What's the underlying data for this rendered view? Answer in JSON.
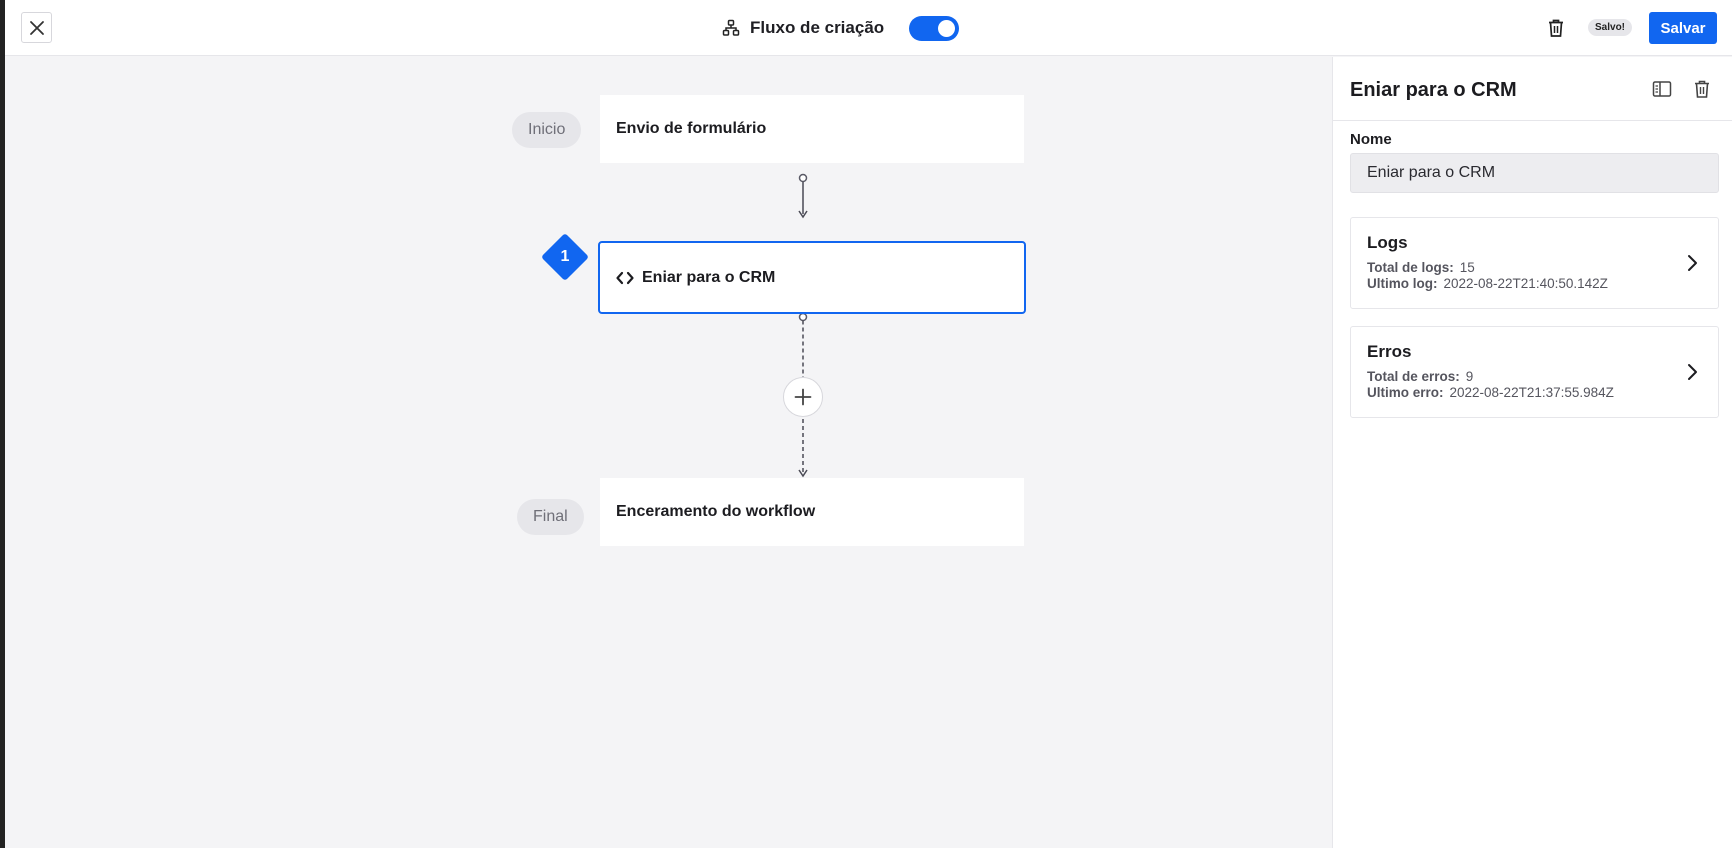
{
  "topbar": {
    "close_icon": "close-icon",
    "flow_icon": "flow-tree-icon",
    "title": "Fluxo de criação",
    "toggle_on": true,
    "trash_icon": "trash-icon",
    "saved_badge": "Salvo!",
    "save_label": "Salvar"
  },
  "canvas": {
    "start_tag": "Inicio",
    "end_tag": "Final",
    "nodes": [
      {
        "label": "Envio de formulário"
      },
      {
        "label": "Eniar para o CRM",
        "number": "1",
        "icon": "code-icon"
      },
      {
        "label": "Enceramento do workflow"
      }
    ],
    "add_icon": "plus-icon"
  },
  "panel": {
    "title": "Eniar para o CRM",
    "layout_icon": "panel-layout-icon",
    "trash_icon": "trash-icon",
    "name_label": "Nome",
    "name_value": "Eniar para o CRM",
    "logs": {
      "title": "Logs",
      "total_label": "Total de logs:",
      "total_value": "15",
      "last_label": "Ultimo log:",
      "last_value": "2022-08-22T21:40:50.142Z"
    },
    "errors": {
      "title": "Erros",
      "total_label": "Total de erros:",
      "total_value": "9",
      "last_label": "Ultimo erro:",
      "last_value": "2022-08-22T21:37:55.984Z"
    }
  },
  "colors": {
    "accent": "#1166f0",
    "background": "#f4f4f6"
  }
}
